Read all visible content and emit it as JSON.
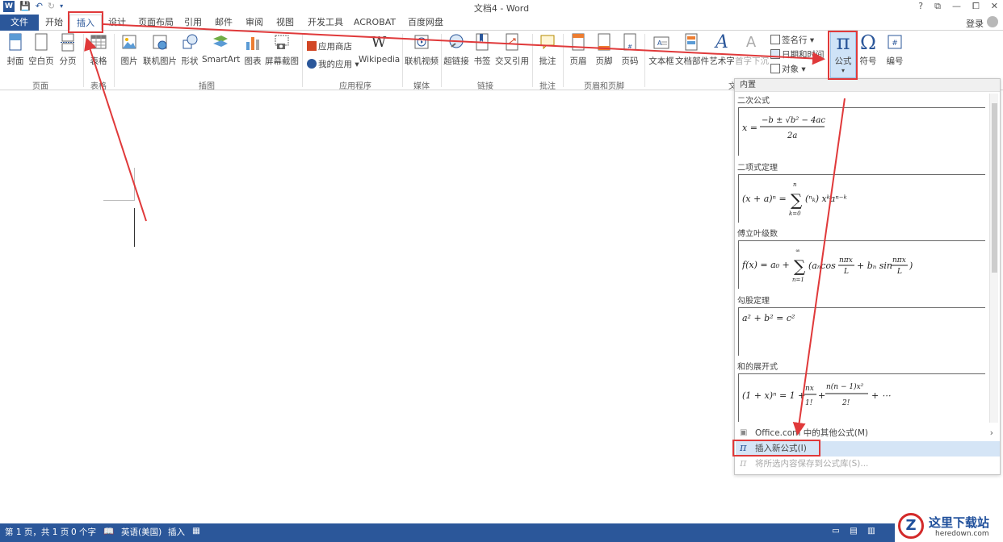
{
  "title": "文档4 - Word",
  "window_controls": [
    "?",
    "⧉",
    "—",
    "⧠",
    "✕"
  ],
  "tabs": [
    "文件",
    "开始",
    "插入",
    "设计",
    "页面布局",
    "引用",
    "邮件",
    "审阅",
    "视图",
    "开发工具",
    "ACROBAT",
    "百度网盘"
  ],
  "active_tab": "插入",
  "login": "登录",
  "ribbon": {
    "pages": {
      "cover": "封面",
      "blank": "空白页",
      "break": "分页",
      "group": "页面"
    },
    "tables": {
      "table": "表格",
      "group": "表格"
    },
    "illustrations": {
      "picture": "图片",
      "online_picture": "联机图片",
      "shapes": "形状",
      "smartart": "SmartArt",
      "chart": "图表",
      "screenshot": "屏幕截图",
      "group": "插图"
    },
    "apps": {
      "store": "应用商店",
      "my_apps": "我的应用",
      "wikipedia": "Wikipedia",
      "group": "应用程序"
    },
    "media": {
      "online_video": "联机视频",
      "group": "媒体"
    },
    "links": {
      "hyperlink": "超链接",
      "bookmark": "书签",
      "crossref": "交叉引用",
      "group": "链接"
    },
    "comments": {
      "comment": "批注",
      "group": "批注"
    },
    "header_footer": {
      "header": "页眉",
      "footer": "页脚",
      "page_number": "页码",
      "group": "页眉和页脚"
    },
    "text": {
      "textbox": "文本框",
      "quick_parts": "文档部件",
      "wordart": "艺术字",
      "dropcap": "首字下沉",
      "signature": "签名行",
      "datetime": "日期和时间",
      "object": "对象",
      "group": "文"
    },
    "symbols": {
      "equation": "公式",
      "symbol": "符号",
      "number": "编号"
    }
  },
  "gallery": {
    "header": "内置",
    "items": [
      {
        "title": "二次公式"
      },
      {
        "title": "二项式定理"
      },
      {
        "title": "傅立叶级数"
      },
      {
        "title": "勾股定理"
      },
      {
        "title": "和的展开式"
      }
    ],
    "menu": {
      "office": "Office.com 中的其他公式(M)",
      "insert_new": "插入新公式(I)",
      "save": "将所选内容保存到公式库(S)..."
    }
  },
  "status": {
    "page": "第 1 页，共 1 页",
    "words": "0 个字",
    "language": "英语(美国)",
    "mode": "插入"
  },
  "watermark": {
    "name": "这里下载站",
    "url": "heredown.com",
    "logo_letter": "Z"
  },
  "colors": {
    "accent": "#2b579a",
    "annotation": "#e0393a",
    "highlight": "#cfe3f7"
  }
}
